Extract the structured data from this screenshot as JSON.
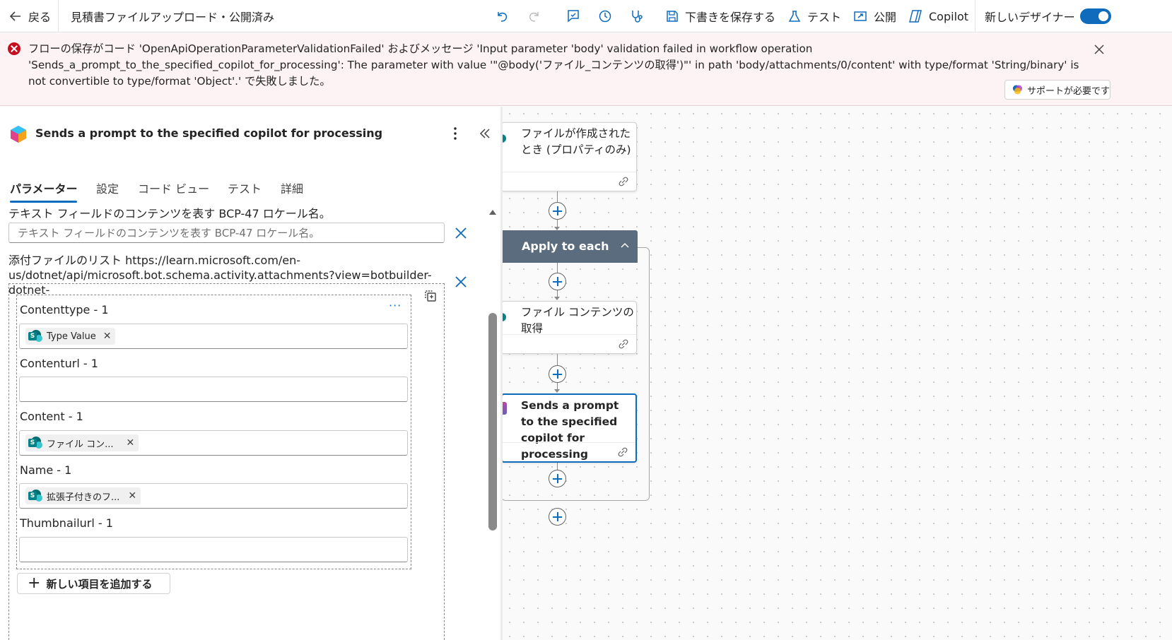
{
  "toolbar": {
    "back_label": "戻る",
    "flow_title": "見積書ファイルアップロード・公開済み",
    "save_draft_label": "下書きを保存する",
    "test_label": "テスト",
    "publish_label": "公開",
    "copilot_label": "Copilot",
    "new_designer_label": "新しいデザイナー",
    "new_designer_on": true
  },
  "error_banner": {
    "message": "フローの保存がコード 'OpenApiOperationParameterValidationFailed' およびメッセージ 'Input parameter 'body' validation failed in workflow operation 'Sends_a_prompt_to_the_specified_copilot_for_processing': The parameter with value '\"@body('ファイル_コンテンツの取得')\"' in path 'body/attachments/0/content' with type/format 'String/binary' is not convertible to type/format 'Object'.' で失敗しました。",
    "support_label": "サポートが必要です",
    "color": "#c50f1f"
  },
  "panel": {
    "title": "Sends a prompt to the specified copilot for processing",
    "tabs": [
      "パラメーター",
      "設定",
      "コード ビュー",
      "テスト",
      "詳細"
    ],
    "active_tab": 0,
    "locale_label": "テキスト フィールドのコンテンツを表す BCP-47 ロケール名。",
    "locale_placeholder": "テキスト フィールドのコンテンツを表す BCP-47 ロケール名。",
    "attachments_label": "添付ファイルのリスト https://learn.microsoft.com/en-us/dotnet/api/microsoft.bot.schema.activity.attachments?view=botbuilder-dotnet-",
    "item_fields": [
      {
        "label": "Contenttype - 1",
        "token": "Type Value"
      },
      {
        "label": "Contenturl - 1",
        "token": ""
      },
      {
        "label": "Content - 1",
        "token": "ファイル コン..."
      },
      {
        "label": "Name - 1",
        "token": "拡張子付きのフ..."
      },
      {
        "label": "Thumbnailurl - 1",
        "token": ""
      }
    ],
    "item_more": "···",
    "add_item_label": "新しい項目を追加する"
  },
  "canvas": {
    "trigger_card": "ファイルが作成されたとき (プロパティのみ)",
    "loop_title": "Apply to each",
    "get_content_card": "ファイル コンテンツの取得",
    "copilot_card": "Sends a prompt to the specified copilot for processing"
  },
  "colors": {
    "accent": "#0f6cbd",
    "loop_header": "#5a6c7d",
    "sharepoint": "#038387"
  }
}
